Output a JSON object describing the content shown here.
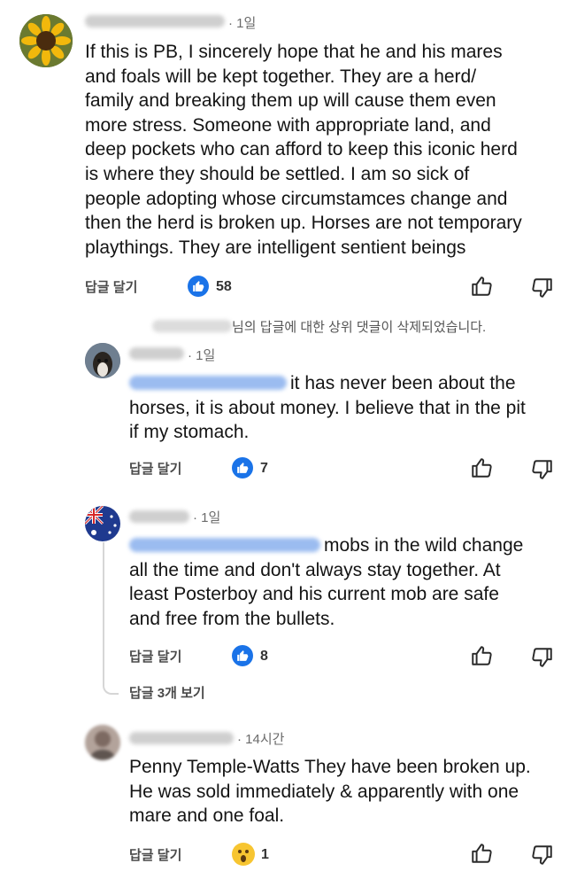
{
  "colors": {
    "like_blue": "#1a73e8",
    "blur_name": "#cfcfcf",
    "blur_mention": "#9bbcf0"
  },
  "comments": [
    {
      "time": "· 1일",
      "text": "If this is PB, I sincerely hope that he and his mares\nand foals will be kept together. They are a herd/\nfamily and breaking them up will cause them even\nmore stress. Someone with appropriate land, and\ndeep pockets who can afford to keep this iconic herd\nis where they should be settled. I am so sick of\npeople adopting whose circumstamces change and\nthen the herd is broken up. Horses are not temporary\nplaythings. They are intelligent sentient beings",
      "reply_label": "답글 달기",
      "reaction_icon": "like-icon",
      "reaction_count": "58"
    }
  ],
  "deleted_note": "님의 답글에 대한 상위 댓글이 삭제되었습니다.",
  "replies": [
    {
      "time": "· 1일",
      "text_line1": "it has never been about the",
      "text_rest": "horses, it is about money. I believe that in the pit\nif my stomach.",
      "reply_label": "답글 달기",
      "reaction_icon": "like-icon",
      "reaction_count": "7"
    },
    {
      "time": "· 1일",
      "text_line1": "mobs in the wild change",
      "text_rest": "all the time and don't always stay together. At\nleast Posterboy and his current mob are safe\nand free from the bullets.",
      "reply_label": "답글 달기",
      "reaction_icon": "like-icon",
      "reaction_count": "8"
    }
  ],
  "view_replies": "답글 3개 보기",
  "last_comment": {
    "time": "· 14시간",
    "text": "Penny Temple-Watts They have been broken up.\nHe was sold immediately & apparently with one\nmare and one foal.",
    "reply_label": "답글 달기",
    "reaction_icon": "wow-icon",
    "reaction_count": "1"
  }
}
